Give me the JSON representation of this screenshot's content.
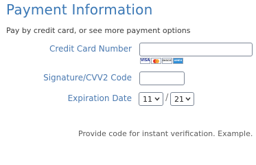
{
  "header": {
    "title": "Payment Information",
    "subtitle": "Pay by credit card, or see more payment options"
  },
  "form": {
    "card_number": {
      "label": "Credit Card Number",
      "value": ""
    },
    "card_logos": [
      {
        "name": "visa",
        "text": "VISA"
      },
      {
        "name": "mastercard",
        "text": ""
      },
      {
        "name": "discover",
        "text": "DISCOVER"
      },
      {
        "name": "amex",
        "text": "AMEX"
      }
    ],
    "cvv": {
      "label": "Signature/CVV2 Code",
      "value": ""
    },
    "expiration": {
      "label": "Expiration Date",
      "month": "11",
      "year": "21",
      "separator": "/"
    }
  },
  "footer": {
    "note": "Provide code for instant verification. Example."
  },
  "colors": {
    "title": "#3b78b5",
    "label": "#4a79b0",
    "border": "#7d8796"
  }
}
